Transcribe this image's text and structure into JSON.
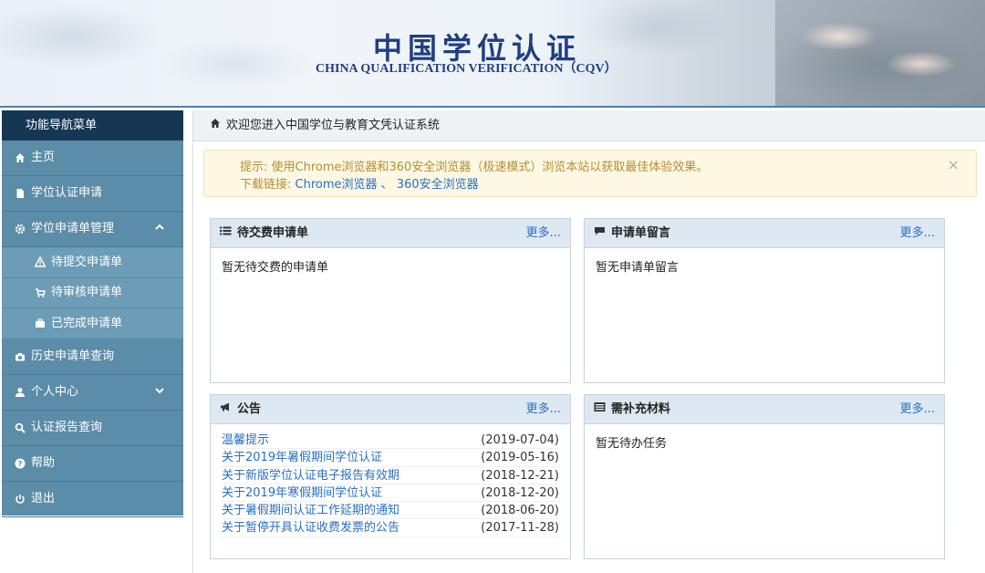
{
  "banner": {
    "title": "中国学位认证",
    "subtitle": "CHINA QUALIFICATION VERIFICATION（CQV）"
  },
  "sidebar": {
    "header": "功能导航菜单",
    "items": [
      {
        "label": "主页",
        "icon": "home-icon"
      },
      {
        "label": "学位认证申请",
        "icon": "document-icon"
      },
      {
        "label": "学位申请单管理",
        "icon": "gear-icon",
        "expanded": true
      },
      {
        "label": "待提交申请单",
        "icon": "warning-icon",
        "sub": true
      },
      {
        "label": "待审核申请单",
        "icon": "cart-icon",
        "sub": true
      },
      {
        "label": "已完成申请单",
        "icon": "briefcase-icon",
        "sub": true
      },
      {
        "label": "历史申请单查询",
        "icon": "camera-icon"
      },
      {
        "label": "个人中心",
        "icon": "user-icon",
        "expanded": false
      },
      {
        "label": "认证报告查询",
        "icon": "search-icon"
      },
      {
        "label": "帮助",
        "icon": "help-icon"
      },
      {
        "label": "退出",
        "icon": "power-icon"
      }
    ]
  },
  "main": {
    "header": "欢迎您进入中国学位与教育文凭认证系统",
    "alert": {
      "line1": "提示: 使用Chrome浏览器和360安全浏览器（极速模式）浏览本站以获取最佳体验效果。",
      "line2_prefix": "下载链接:",
      "link1": "Chrome浏览器",
      "separator": "、",
      "link2": "360安全浏览器",
      "close": "×"
    },
    "panels": {
      "pending_payment": {
        "title": "待交费申请单",
        "more": "更多...",
        "empty": "暂无待交费的申请单"
      },
      "messages": {
        "title": "申请单留言",
        "more": "更多...",
        "empty": "暂无申请单留言"
      },
      "notices": {
        "title": "公告",
        "more": "更多...",
        "items": [
          {
            "title": "温馨提示",
            "date": "(2019-07-04)"
          },
          {
            "title": "关于2019年暑假期间学位认证",
            "date": "(2019-05-16)"
          },
          {
            "title": "关于新版学位认证电子报告有效期",
            "date": "(2018-12-21)"
          },
          {
            "title": "关于2019年寒假期间学位认证",
            "date": "(2018-12-20)"
          },
          {
            "title": "关于暑假期间认证工作延期的通知",
            "date": "(2018-06-20)"
          },
          {
            "title": "关于暂停开具认证收费发票的公告",
            "date": "(2017-11-28)"
          }
        ]
      },
      "materials": {
        "title": "需补充材料",
        "more": "更多...",
        "empty": "暂无待办任务"
      }
    }
  }
}
